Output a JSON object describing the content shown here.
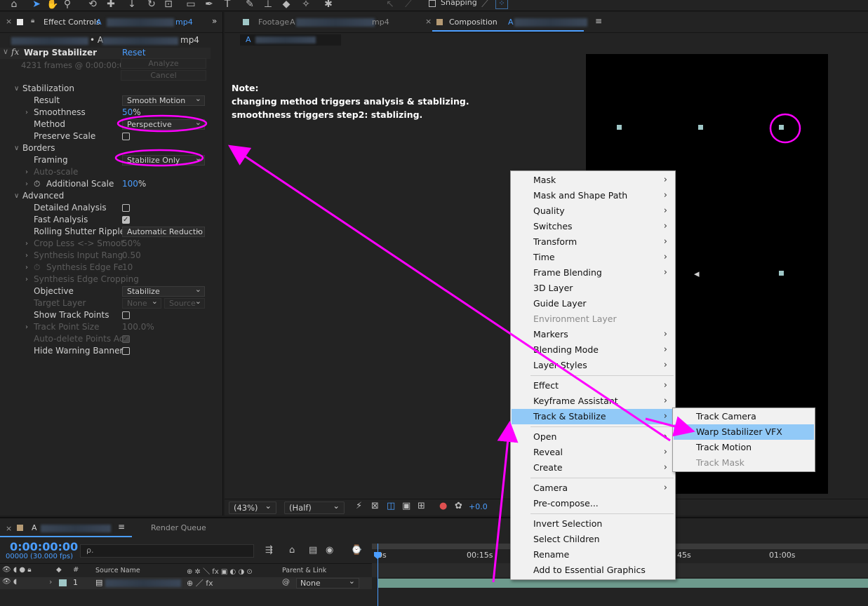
{
  "colors": {
    "accent_blue": "#4b9eff",
    "annotation_magenta": "#ff00ff",
    "menu_highlight": "#91c9f7"
  },
  "toolbar": {
    "snapping_label": "Snapping"
  },
  "effect_controls": {
    "tab_title": "Effect Controls",
    "tab_prefix": "A",
    "tab_suffix": "mp4",
    "layer_prefix": "• A",
    "layer_suffix": "mp4",
    "effect_name": "Warp Stabilizer",
    "fx_label": "fx",
    "reset_label": "Reset",
    "frames_info": "4231 frames @ 0:00:00:0",
    "analyze_label": "Analyze",
    "cancel_label": "Cancel",
    "rows": {
      "stabilization": "Stabilization",
      "result": {
        "label": "Result",
        "value": "Smooth Motion"
      },
      "smoothness": {
        "label": "Smoothness",
        "value": "50",
        "unit": "%"
      },
      "method": {
        "label": "Method",
        "value": "Perspective"
      },
      "preserve_scale": {
        "label": "Preserve Scale",
        "checked": false
      },
      "borders": "Borders",
      "framing": {
        "label": "Framing",
        "value": "Stabilize Only"
      },
      "auto_scale": "Auto-scale",
      "additional_scale": {
        "label": "Additional Scale",
        "value": "100",
        "unit": "%"
      },
      "advanced": "Advanced",
      "detailed_analysis": {
        "label": "Detailed Analysis",
        "checked": false
      },
      "fast_analysis": {
        "label": "Fast Analysis",
        "checked": true
      },
      "rolling_shutter": {
        "label": "Rolling Shutter Ripple",
        "value": "Automatic Reductio"
      },
      "crop_less": {
        "label": "Crop Less <-> Smoot",
        "value": "50%"
      },
      "synth_input": {
        "label": "Synthesis Input Rang",
        "value": "0.50"
      },
      "synth_edge_fe": {
        "label": "Synthesis Edge Fe",
        "value": "10"
      },
      "synth_edge_crop": {
        "label": "Synthesis Edge Cropping"
      },
      "objective": {
        "label": "Objective",
        "value": "Stabilize"
      },
      "target_layer": {
        "label": "Target Layer",
        "value1": "None",
        "value2": "Source"
      },
      "show_track_points": {
        "label": "Show Track Points",
        "checked": false
      },
      "track_point_size": {
        "label": "Track Point Size",
        "value": "100.0%"
      },
      "auto_delete": {
        "label": "Auto-delete Points Ac",
        "checked": true
      },
      "hide_warning": {
        "label": "Hide Warning Banner",
        "checked": false
      }
    }
  },
  "viewer": {
    "footage_tab": "Footage",
    "footage_prefix": "A",
    "footage_suffix": "mp4",
    "composition_tab": "Composition",
    "comp_prefix": "A",
    "comp_label": "A",
    "zoom": "(43%)",
    "resolution": "(Half)",
    "exposure": "+0.0"
  },
  "note": {
    "line1": "Note:",
    "line2": "changing method triggers analysis & stablizing.",
    "line3": "smoothness triggers step2: stablizing."
  },
  "timeline": {
    "comp_tab": "A",
    "render_queue": "Render Queue",
    "timecode": "0:00:00:00",
    "fps": "00000 (30.000 fps)",
    "search_placeholder": "ρ.",
    "col_source_name": "Source Name",
    "col_parent": "Parent & Link",
    "layer_number": "1",
    "parent_value": "None",
    "ruler": [
      "0s",
      "00:15s",
      "45s",
      "01:00s"
    ]
  },
  "context_menu": {
    "items": [
      {
        "label": "Mask",
        "submenu": true
      },
      {
        "label": "Mask and Shape Path",
        "submenu": true
      },
      {
        "label": "Quality",
        "submenu": true
      },
      {
        "label": "Switches",
        "submenu": true
      },
      {
        "label": "Transform",
        "submenu": true
      },
      {
        "label": "Time",
        "submenu": true
      },
      {
        "label": "Frame Blending",
        "submenu": true
      },
      {
        "label": "3D Layer",
        "submenu": false
      },
      {
        "label": "Guide Layer",
        "submenu": false
      },
      {
        "label": "Environment Layer",
        "submenu": false,
        "disabled": true
      },
      {
        "label": "Markers",
        "submenu": true
      },
      {
        "label": "Blending Mode",
        "submenu": true
      },
      {
        "label": "Layer Styles",
        "submenu": true
      },
      {
        "label": "Effect",
        "submenu": true
      },
      {
        "label": "Keyframe Assistant",
        "submenu": true
      },
      {
        "label": "Track & Stabilize",
        "submenu": true,
        "highlighted": true
      },
      {
        "label": "Open",
        "submenu": true
      },
      {
        "label": "Reveal",
        "submenu": true
      },
      {
        "label": "Create",
        "submenu": true
      },
      {
        "label": "Camera",
        "submenu": true
      },
      {
        "label": "Pre-compose...",
        "submenu": false
      },
      {
        "label": "Invert Selection",
        "submenu": false
      },
      {
        "label": "Select Children",
        "submenu": false
      },
      {
        "label": "Rename",
        "submenu": false
      },
      {
        "label": "Add to Essential Graphics",
        "submenu": false
      }
    ],
    "submenu_items": [
      {
        "label": "Track Camera"
      },
      {
        "label": "Warp Stabilizer VFX",
        "highlighted": true
      },
      {
        "label": "Track Motion"
      },
      {
        "label": "Track Mask",
        "disabled": true
      }
    ]
  }
}
